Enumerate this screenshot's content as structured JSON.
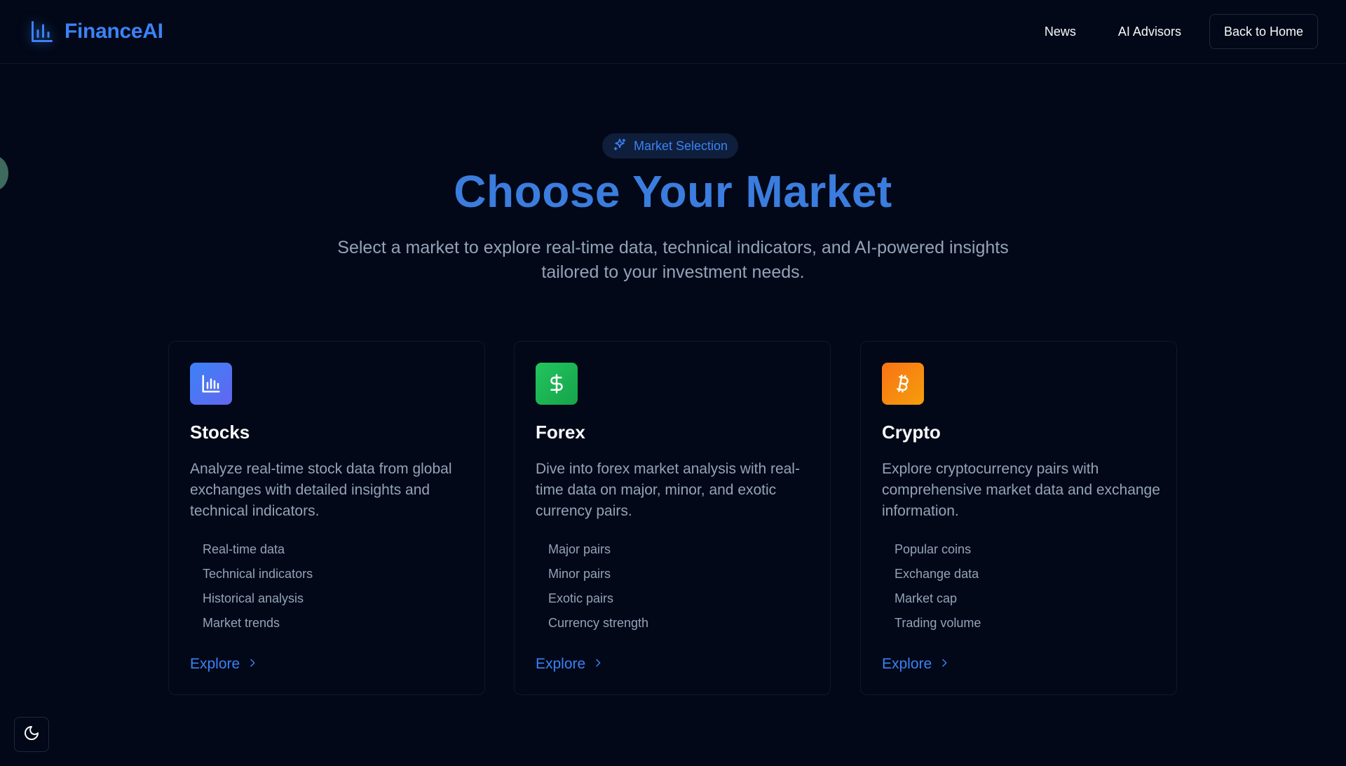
{
  "brand": {
    "name": "FinanceAI",
    "icon": "bar-chart-icon",
    "color": "#3b82f6"
  },
  "nav": {
    "links": [
      {
        "label": "News"
      },
      {
        "label": "AI Advisors"
      }
    ],
    "home_button": "Back to Home"
  },
  "hero": {
    "badge": {
      "label": "Market Selection",
      "icon": "sparkles-icon"
    },
    "title": "Choose Your Market",
    "subtitle": "Select a market to explore real-time data, technical indicators, and AI-powered insights tailored to your investment needs."
  },
  "cards": [
    {
      "title": "Stocks",
      "icon": "bar-chart-icon",
      "icon_colors": [
        "#3b82f6",
        "#6366f1"
      ],
      "description": "Analyze real-time stock data from global exchanges with detailed insights and technical indicators.",
      "features": [
        "Real-time data",
        "Technical indicators",
        "Historical analysis",
        "Market trends"
      ],
      "cta": "Explore"
    },
    {
      "title": "Forex",
      "icon": "dollar-icon",
      "icon_colors": [
        "#22c55e",
        "#16a34a"
      ],
      "description": "Dive into forex market analysis with real-time data on major, minor, and exotic currency pairs.",
      "features": [
        "Major pairs",
        "Minor pairs",
        "Exotic pairs",
        "Currency strength"
      ],
      "cta": "Explore"
    },
    {
      "title": "Crypto",
      "icon": "bitcoin-icon",
      "icon_colors": [
        "#f97316",
        "#f59e0b"
      ],
      "description": "Explore cryptocurrency pairs with comprehensive market data and exchange information.",
      "features": [
        "Popular coins",
        "Exchange data",
        "Market cap",
        "Trading volume"
      ],
      "cta": "Explore"
    }
  ],
  "theme_toggle": {
    "icon": "moon-icon"
  }
}
